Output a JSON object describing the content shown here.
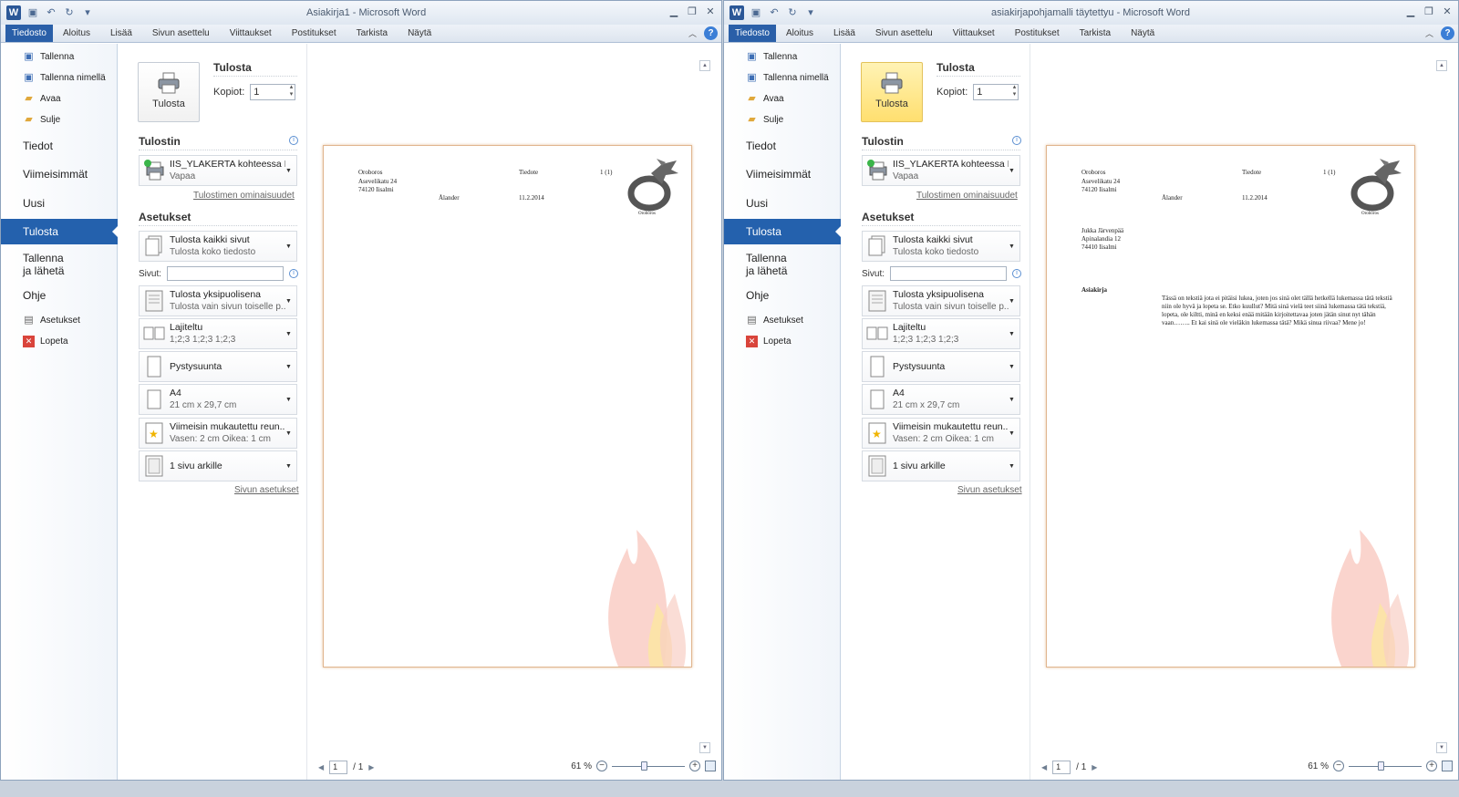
{
  "ribbon_tabs": [
    "Tiedosto",
    "Aloitus",
    "Lisää",
    "Sivun asettelu",
    "Viittaukset",
    "Postitukset",
    "Tarkista",
    "Näytä"
  ],
  "nav": {
    "save": "Tallenna",
    "save_as": "Tallenna nimellä",
    "open": "Avaa",
    "close": "Sulje",
    "info": "Tiedot",
    "recent": "Viimeisimmät",
    "new": "Uusi",
    "print": "Tulosta",
    "share_l1": "Tallenna",
    "share_l2": "ja lähetä",
    "help": "Ohje",
    "options": "Asetukset",
    "exit": "Lopeta"
  },
  "print": {
    "heading": "Tulosta",
    "button": "Tulosta",
    "copies_label": "Kopiot:",
    "copies_value": "1",
    "printer_heading": "Tulostin",
    "printer_name": "IIS_YLAKERTA kohteessa IIS...",
    "printer_status": "Vapaa",
    "printer_props": "Tulostimen ominaisuudet",
    "settings_heading": "Asetukset",
    "pages_label": "Sivut:",
    "page_setup": "Sivun asetukset",
    "options": [
      {
        "t1": "Tulosta kaikki sivut",
        "t2": "Tulosta koko tiedosto"
      },
      {
        "t1": "Tulosta yksipuolisena",
        "t2": "Tulosta vain sivun toiselle p..."
      },
      {
        "t1": "Lajiteltu",
        "t2": "1;2;3   1;2;3   1;2;3"
      },
      {
        "t1": "Pystysuunta",
        "t2": ""
      },
      {
        "t1": "A4",
        "t2": "21 cm x 29,7 cm"
      },
      {
        "t1": "Viimeisin mukautettu reun...",
        "t2": "Vasen:  2 cm    Oikea:  1 cm"
      },
      {
        "t1": "1 sivu arkille",
        "t2": ""
      }
    ]
  },
  "preview_bar": {
    "page": "1",
    "of": "/ 1",
    "zoom": "61 %"
  },
  "windows": [
    {
      "title": "Asiakirja1  -  Microsoft Word",
      "doc": {
        "sender_name": "Oroboros",
        "sender_street": "Asevelikatu 24",
        "sender_city": "74120 Iisalmi",
        "doctype": "Tiedote",
        "pagenum": "1 (1)",
        "author": "Ålander",
        "date": "11.2.2014",
        "logo_caption": "Oroboros",
        "recipient_name": "",
        "recipient_street": "",
        "recipient_city": "",
        "subject": "",
        "body": ""
      }
    },
    {
      "title": "asiakirjapohjamalli täytettyu  -  Microsoft Word",
      "doc": {
        "sender_name": "Oroboros",
        "sender_street": "Asevelikatu 24",
        "sender_city": "74120 Iisalmi",
        "doctype": "Tiedote",
        "pagenum": "1 (1)",
        "author": "Ålander",
        "date": "11.2.2014",
        "logo_caption": "Oroboros",
        "recipient_name": "Jukka Järvenpää",
        "recipient_street": "Apinalandia 12",
        "recipient_city": "74410 Iisalmi",
        "subject": "Asiakirja",
        "body": "Tässä on tekstiä jota ei pitäisi lukea, joten jos sinä olet tällä hetkellä lukemassa tätä tekstiä niin ole hyvä ja lopeta se. Etko kuullut? Mitä sinä vielä teet siinä lukemassa tätä tekstiä, lopeta, ole kiltti, minä en keksi enää mitään kirjoitettavaa joten jätän sinut nyt tähän vaan…….. Et kai sinä ole vieläkin lukemassa tätä? Mikä sinua riivaa? Mene jo!"
      }
    }
  ],
  "colors": {
    "accent": "#2461ad",
    "file_tab": "#2a5fa8",
    "print_active": "#ffdf6f",
    "page_border": "#e0b58e"
  }
}
